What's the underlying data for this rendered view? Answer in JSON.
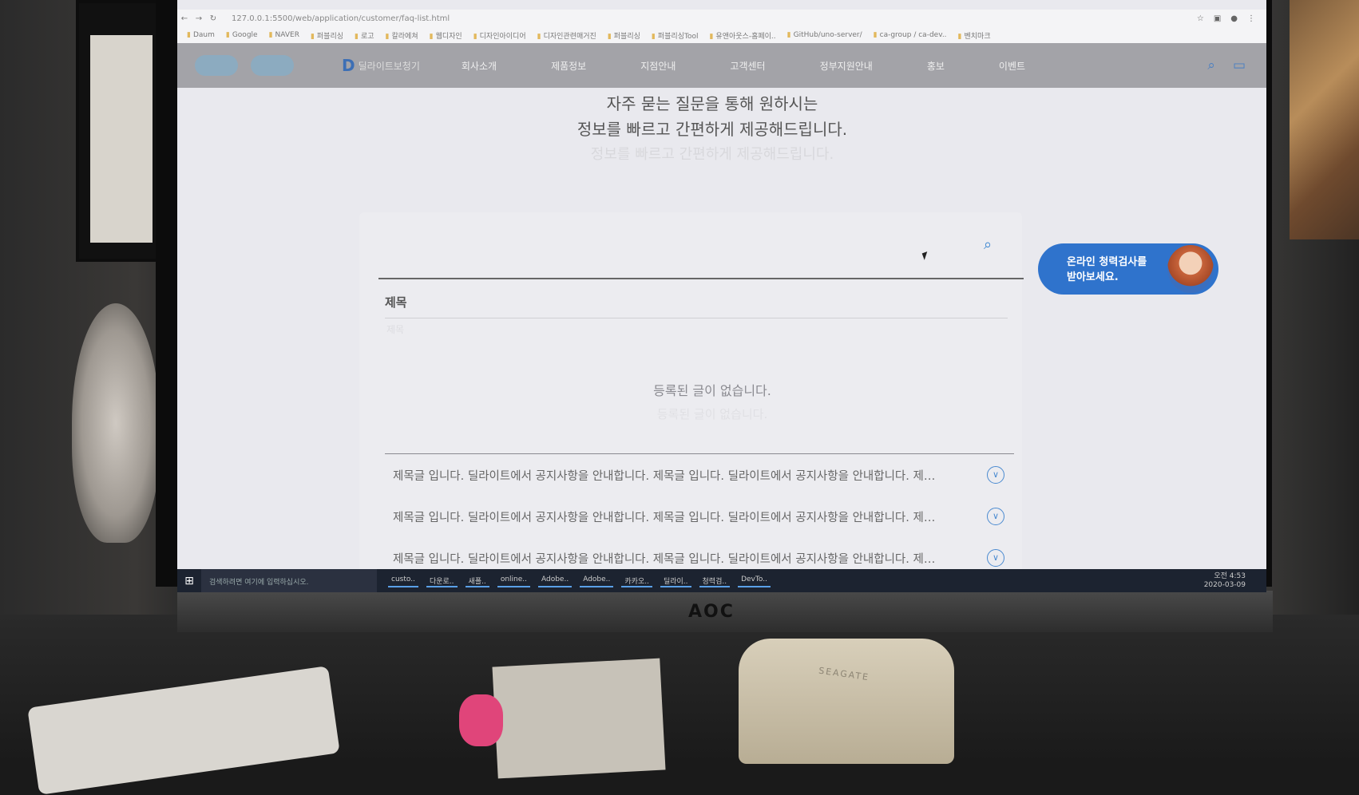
{
  "browser": {
    "url": "127.0.0.1:5500/web/application/customer/faq-list.html",
    "bookmarks": [
      "Daum",
      "Google",
      "NAVER",
      "퍼블리싱",
      "로고",
      "칼라에쳐",
      "웹디자인",
      "디자인아이디어",
      "디자인관련매거진",
      "퍼블리싱",
      "퍼블리싱Tool",
      "유앤아웃스-홈페이..",
      "GitHub/uno-server/",
      "ca-group / ca-dev..",
      "벤치마크"
    ]
  },
  "site_header": {
    "logo": "딜라이트보청기",
    "nav": [
      "회사소개",
      "제품정보",
      "지점안내",
      "고객센터",
      "정부지원안내",
      "홍보",
      "이벤트"
    ]
  },
  "intro": {
    "line1": "자주 묻는 질문을 통해 원하시는",
    "line2": "정보를 빠르고 간편하게 제공해드립니다.",
    "line2_ghost": "정보를 빠르고 간편하게 제공해드립니다."
  },
  "search": {
    "placeholder": ""
  },
  "table": {
    "title_label": "제목",
    "title_ghost": "제목",
    "empty_message": "등록된 글이 없습니다.",
    "empty_ghost": "등록된 글이 없습니다."
  },
  "faq_items": [
    "제목글 입니다. 딜라이트에서 공지사항을 안내합니다. 제목글 입니다. 딜라이트에서 공지사항을 안내합니다. 제…",
    "제목글 입니다. 딜라이트에서 공지사항을 안내합니다. 제목글 입니다. 딜라이트에서 공지사항을 안내합니다. 제…",
    "제목글 입니다. 딜라이트에서 공지사항을 안내합니다. 제목글 입니다. 딜라이트에서 공지사항을 안내합니다. 제…"
  ],
  "chat_bubble": {
    "line1": "온라인 청력검사를",
    "line2": "받아보세요."
  },
  "taskbar": {
    "search_placeholder": "검색하려면 여기에 입력하십시오.",
    "apps": [
      "custo..",
      "다운로..",
      "새폴..",
      "online..",
      "Adobe..",
      "Adobe..",
      "카카오..",
      "딜라이..",
      "청력검..",
      "DevTo.."
    ],
    "time": "오전 4:53",
    "date": "2020-03-09"
  },
  "physical": {
    "monitor_brand": "AOC",
    "case_brand": "SEAGATE"
  },
  "colors": {
    "accent": "#2f73cc",
    "header_bg": "#a3a3a8",
    "page_bg": "#e9e9ee"
  }
}
